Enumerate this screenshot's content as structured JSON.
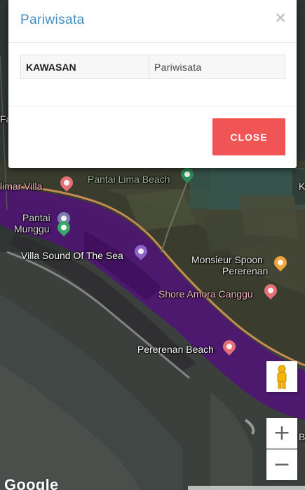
{
  "modal": {
    "title": "Pariwisata",
    "close_symbol": "×",
    "table": {
      "key": "KAWASAN",
      "value": "Pariwisata"
    },
    "close_button_label": "CLOSE"
  },
  "map": {
    "labels": {
      "pantai_lima": "Pantai Lima Beach",
      "limar_villa": "limar Villa",
      "pantai": "Pantai",
      "munggu": "Munggu",
      "villa_sound": "Villa Sound Of The Sea",
      "monsieur_1": "Monsieur Spoon",
      "monsieur_2": "Pererenan",
      "shore_amora": "Shore Amora Canggu",
      "pererenan_beach": "Pererenan Beach",
      "edge_fa": "Fa",
      "edge_k": "K",
      "edge_b": "B"
    },
    "zoom_in": "+",
    "zoom_out": "−",
    "google": "Google",
    "zone_color": "#5b1a7a",
    "accent": "#f05454"
  }
}
